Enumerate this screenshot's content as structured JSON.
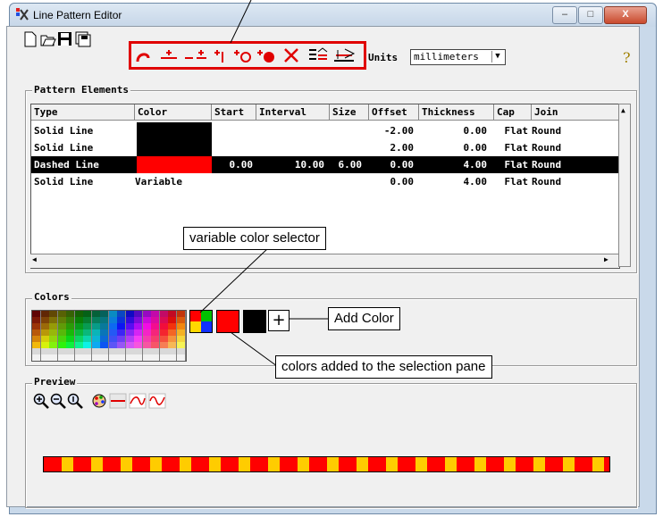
{
  "window": {
    "title": "Line Pattern Editor",
    "minimize": "–",
    "maximize": "□",
    "close": "X"
  },
  "toolbar": {
    "icons": [
      "new-icon",
      "open-icon",
      "save-icon",
      "save-as-icon"
    ],
    "pattern_tools": [
      "arc-icon",
      "add-dash-icon",
      "add-dash-pair-icon",
      "add-tick-icon",
      "add-circle-icon",
      "add-dot-icon",
      "delete-icon",
      "edit-elements-icon",
      "edit-elements-alt-icon"
    ],
    "units_label": "Units",
    "units_value": "millimeters",
    "help_icon": "?"
  },
  "pattern_elements": {
    "label": "Pattern Elements",
    "columns": [
      "Type",
      "Color",
      "Start",
      "Interval",
      "Size",
      "Offset",
      "Thickness",
      "Cap",
      "Join"
    ],
    "rows": [
      {
        "type": "Solid Line",
        "color": "#000000",
        "color_text": "",
        "start": "",
        "interval": "",
        "size": "",
        "offset": "-2.00",
        "thickness": "0.00",
        "cap": "Flat",
        "join": "Round",
        "selected": false
      },
      {
        "type": "Solid Line",
        "color": "#000000",
        "color_text": "",
        "start": "",
        "interval": "",
        "size": "",
        "offset": "2.00",
        "thickness": "0.00",
        "cap": "Flat",
        "join": "Round",
        "selected": false
      },
      {
        "type": "Dashed Line",
        "color": "#ff0000",
        "color_text": "",
        "start": "0.00",
        "interval": "10.00",
        "size": "6.00",
        "offset": "0.00",
        "thickness": "4.00",
        "cap": "Flat",
        "join": "Round",
        "selected": true
      },
      {
        "type": "Solid Line",
        "color": "",
        "color_text": "Variable",
        "start": "",
        "interval": "",
        "size": "",
        "offset": "0.00",
        "thickness": "4.00",
        "cap": "Flat",
        "join": "Round",
        "selected": false
      }
    ]
  },
  "colors": {
    "label": "Colors",
    "added": [
      "#ff0000",
      "#000000"
    ],
    "add_button": "+"
  },
  "preview": {
    "label": "Preview",
    "tools": [
      "zoom-in-icon",
      "zoom-out-icon",
      "zoom-full-icon",
      "color-palette-icon",
      "straight-line-icon",
      "curve-icon",
      "wave-icon"
    ],
    "line_colors": [
      "#ff0000",
      "#ffcc00"
    ]
  },
  "callouts": {
    "variable_color": "variable color selector",
    "add_color": "Add Color",
    "colors_added": "colors added to the selection pane"
  }
}
